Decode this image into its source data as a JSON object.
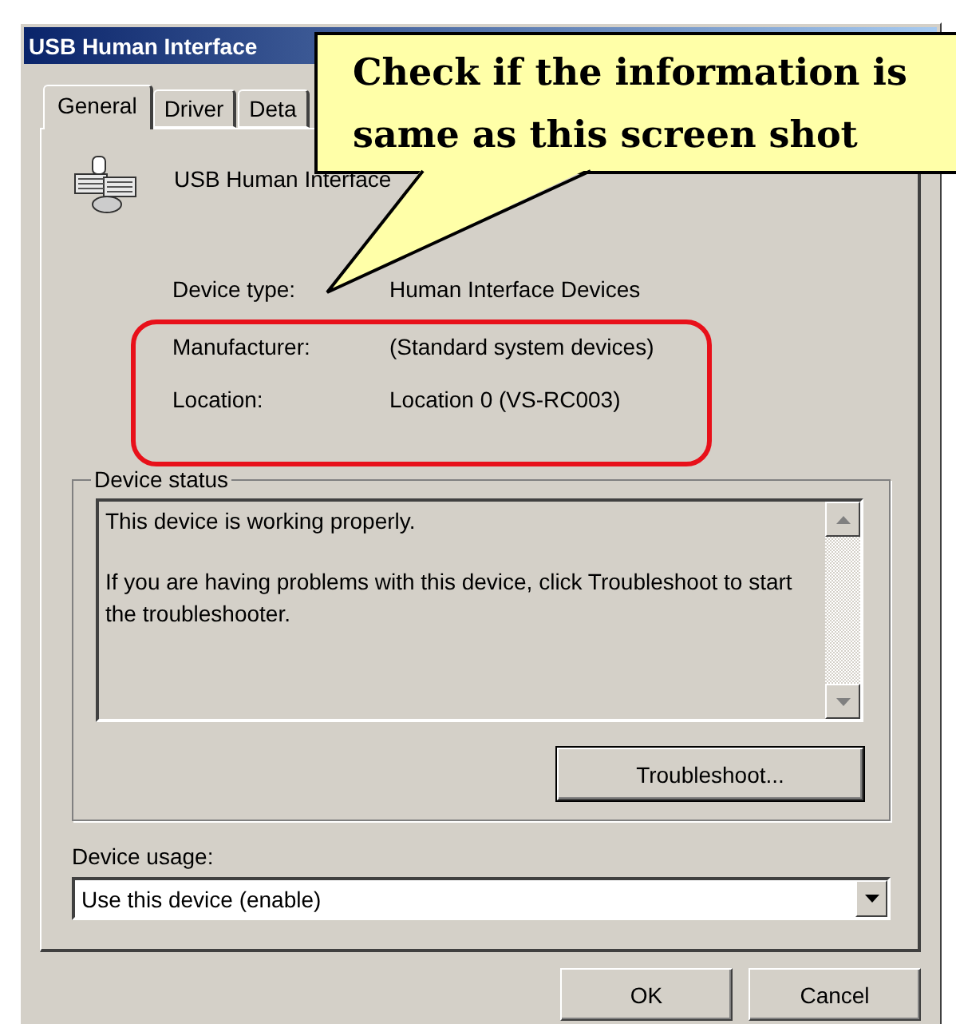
{
  "window": {
    "title": "USB Human Interface"
  },
  "tabs": [
    {
      "label": "General",
      "selected": true
    },
    {
      "label": "Driver",
      "selected": false
    },
    {
      "label": "Deta",
      "selected": false
    }
  ],
  "device": {
    "name": "USB Human Interface"
  },
  "properties": [
    {
      "label": "Device type:",
      "value": "Human Interface Devices",
      "highlighted": false
    },
    {
      "label": "Manufacturer:",
      "value": "(Standard system devices)",
      "highlighted": true
    },
    {
      "label": "Location:",
      "value": "Location 0 (VS-RC003)",
      "highlighted": true
    }
  ],
  "device_status": {
    "title": "Device status",
    "lines": [
      "This device is working properly.",
      "If you are having problems with this device, click Troubleshoot to start the troubleshooter."
    ]
  },
  "troubleshoot_button": "Troubleshoot...",
  "device_usage": {
    "label": "Device usage:",
    "value": "Use this device (enable)"
  },
  "buttons": [
    "OK",
    "Cancel"
  ],
  "callout": {
    "lines": [
      "Check if the information is",
      "same as this screen shot"
    ]
  }
}
